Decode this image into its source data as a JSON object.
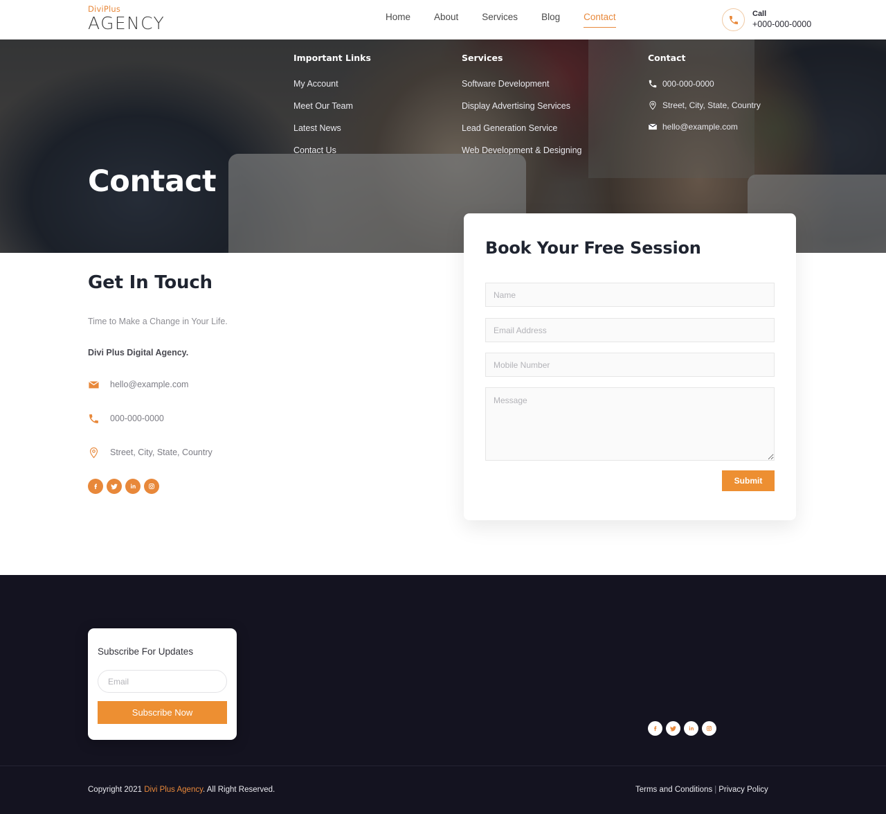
{
  "header": {
    "logo_top": "DiviPlus",
    "logo_bottom": "AGENCY",
    "nav": [
      {
        "label": "Home",
        "active": false
      },
      {
        "label": "About",
        "active": false
      },
      {
        "label": "Services",
        "active": false
      },
      {
        "label": "Blog",
        "active": false
      },
      {
        "label": "Contact",
        "active": true
      }
    ],
    "call_label": "Call",
    "call_number": "+000-000-0000",
    "accent_color": "#E8883A"
  },
  "hero": {
    "title": "Contact"
  },
  "get_in_touch": {
    "title": "Get In Touch",
    "subtitle": "Time to Make a Change in Your Life.",
    "company": "Divi Plus Digital Agency.",
    "email": "hello@example.com",
    "phone": "000-000-0000",
    "address": "Street, City, State, Country",
    "socials": [
      "facebook-icon",
      "twitter-icon",
      "linkedin-icon",
      "instagram-icon"
    ]
  },
  "form": {
    "title": "Book Your Free Session",
    "name_placeholder": "Name",
    "email_placeholder": "Email Address",
    "mobile_placeholder": "Mobile Number",
    "message_placeholder": "Message",
    "submit_label": "Submit",
    "button_color": "#ED8F32"
  },
  "footer": {
    "subscribe": {
      "title": "Subscribe For Updates",
      "email_placeholder": "Email",
      "button_label": "Subscribe Now"
    },
    "links_column": {
      "heading": "Important Links",
      "items": [
        "My Account",
        "Meet Our Team",
        "Latest News",
        "Contact Us"
      ]
    },
    "services_column": {
      "heading": "Services",
      "items": [
        "Software Development",
        "Display Advertising Services",
        "Lead Generation Service",
        "Web Development & Designing"
      ]
    },
    "contact_column": {
      "heading": "Contact",
      "phone": "000-000-0000",
      "address": "Street, City, State, Country",
      "email": "hello@example.com",
      "socials": [
        "facebook-icon",
        "twitter-icon",
        "linkedin-icon",
        "instagram-icon"
      ]
    },
    "copyright_prefix": "Copyright 2021 ",
    "copyright_brand": "Divi Plus Agency",
    "copyright_suffix": ". All Right Reserved.",
    "terms_label": "Terms and Conditions",
    "separator": "|",
    "privacy_label": "Privacy Policy",
    "background_color": "#141320"
  }
}
